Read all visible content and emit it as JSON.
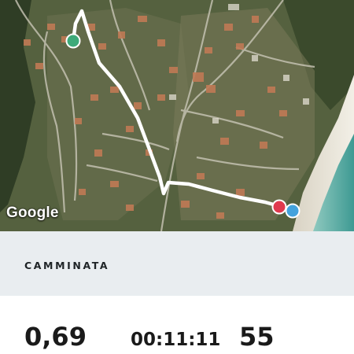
{
  "map": {
    "attribution": "Google",
    "route_color": "#ffffff",
    "start_marker_color": "#3daa79",
    "end_marker_color": "#e0394e",
    "location_marker_color": "#43a2dc"
  },
  "activity": {
    "type_label": "CAMMINATA"
  },
  "stats": {
    "distance": "0,69",
    "duration": "00:11:11",
    "pace": "55"
  }
}
